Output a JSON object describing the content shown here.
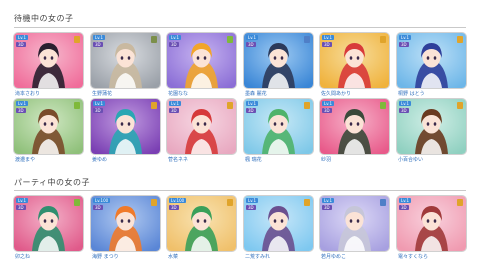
{
  "sections": {
    "waiting": {
      "title": "待機中の女の子",
      "cards": [
        {
          "name": "滝本さおり",
          "lv": "Lv.1",
          "mode": "3D",
          "bg": "#f06c9a",
          "bg2": "#f6b7cc",
          "hair": "#2a1f2f",
          "icon": "#e0a42a"
        },
        {
          "name": "生野蒲花",
          "lv": "Lv.1",
          "mode": "3D",
          "bg": "#9aa0a8",
          "bg2": "#d9dce0",
          "hair": "#c9b9a0",
          "icon": "#7b8f4a"
        },
        {
          "name": "花園なな",
          "lv": "Lv.1",
          "mode": "3D",
          "bg": "#8b6ed6",
          "bg2": "#c6b3f0",
          "hair": "#f2a52a",
          "icon": "#7fb93a"
        },
        {
          "name": "墨森 麗花",
          "lv": "Lv.1",
          "mode": "3D",
          "bg": "#3a86d6",
          "bg2": "#9cc9f2",
          "hair": "#2c3a5a",
          "icon": "#4f7fc7"
        },
        {
          "name": "佐久間あかり",
          "lv": "Lv.1",
          "mode": "3D",
          "bg": "#f0b23c",
          "bg2": "#f6dc9a",
          "hair": "#d83a3a",
          "icon": "#e0a42a"
        },
        {
          "name": "桐野 はとう",
          "lv": "Lv.1",
          "mode": "3D",
          "bg": "#6db6e8",
          "bg2": "#bde0f7",
          "hair": "#2f3f9a",
          "icon": "#e0a42a"
        },
        {
          "name": "渡邉まや",
          "lv": "Lv.1",
          "mode": "3D",
          "bg": "#8fc07a",
          "bg2": "#cfe7c2",
          "hair": "#7a4a2a",
          "icon": "#7fb93a"
        },
        {
          "name": "姜ゆめ",
          "lv": "Lv.1",
          "mode": "3D",
          "bg": "#7a3fb3",
          "bg2": "#c09ae0",
          "hair": "#2aa7b3",
          "icon": "#e0a42a"
        },
        {
          "name": "菅名ネネ",
          "lv": "Lv.1",
          "mode": "3D",
          "bg": "#e8a8c0",
          "bg2": "#f6d6e2",
          "hair": "#d63a3a",
          "icon": "#e0a42a"
        },
        {
          "name": "楓 瑞花",
          "lv": "Lv.1",
          "mode": "3D",
          "bg": "#7ec8e8",
          "bg2": "#c6e8f6",
          "hair": "#4fb36a",
          "icon": "#e0a42a"
        },
        {
          "name": "紗羽",
          "lv": "Lv.1",
          "mode": "3D",
          "bg": "#e85a8a",
          "bg2": "#f6b0c8",
          "hair": "#3a4a3a",
          "icon": "#7fb93a"
        },
        {
          "name": "小百合ゆい",
          "lv": "Lv.1",
          "mode": "3D",
          "bg": "#8fd0c0",
          "bg2": "#d0eee6",
          "hair": "#6a3a1f",
          "icon": "#e0a42a"
        }
      ]
    },
    "party": {
      "title": "パーティ中の女の子",
      "cards": [
        {
          "name": "卯之ね",
          "lv": "Lv.1",
          "mode": "3D",
          "bg": "#e05a8a",
          "bg2": "#f3b0c8",
          "hair": "#2f8f6f",
          "icon": "#7fb93a"
        },
        {
          "name": "海野 まつり",
          "lv": "Lv.100",
          "mode": "3D",
          "bg": "#5a86d6",
          "bg2": "#b0c9f0",
          "hair": "#f07a2a",
          "icon": "#e0a42a"
        },
        {
          "name": "水菜",
          "lv": "Lv.100",
          "mode": "3D",
          "bg": "#f0c06a",
          "bg2": "#f8e2b0",
          "hair": "#3aa05a",
          "icon": "#e0a42a"
        },
        {
          "name": "二荒すみれ",
          "lv": "Lv.1",
          "mode": "3D",
          "bg": "#7ec8f0",
          "bg2": "#c6e6f8",
          "hair": "#6a4f8f",
          "icon": "#e0a42a"
        },
        {
          "name": "若月ゆめこ",
          "lv": "Lv.1",
          "mode": "3D",
          "bg": "#a7a0e0",
          "bg2": "#dcd8f6",
          "hair": "#c6c6d8",
          "icon": "#4f7fc7"
        },
        {
          "name": "電々すくなら",
          "lv": "Lv.1",
          "mode": "3D",
          "bg": "#f09ab0",
          "bg2": "#f8d0dc",
          "hair": "#a03a3a",
          "icon": "#e0a42a"
        }
      ]
    }
  }
}
